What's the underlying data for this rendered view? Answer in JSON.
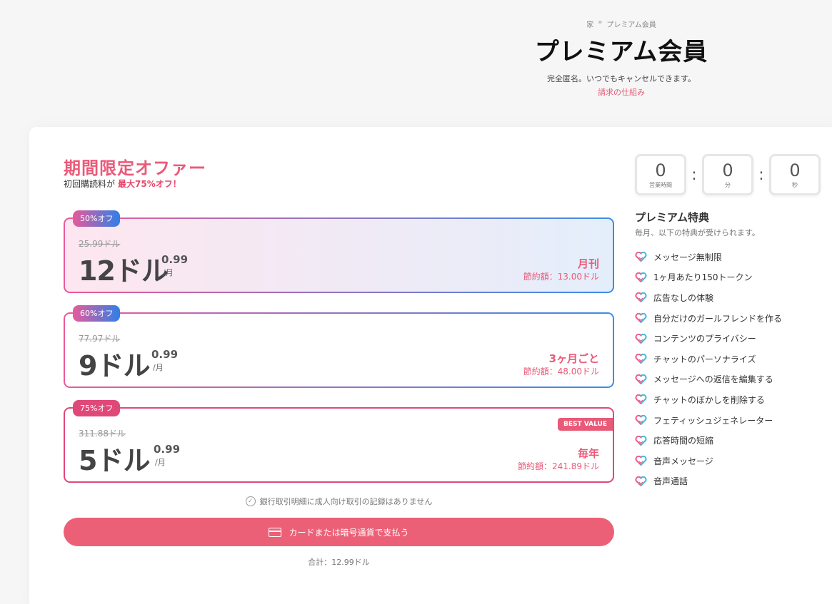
{
  "header": {
    "breadcrumb": [
      "家",
      "プレミアム会員"
    ],
    "breadcrumb_sep": "»",
    "title": "プレミアム会員",
    "subtitle": "完全匿名。いつでもキャンセルできます。",
    "billing_link": "請求の仕組み"
  },
  "offer": {
    "title": "期間限定オファー",
    "subtitle": "初回購読料が",
    "highlight": "最大75%オフ！"
  },
  "plans": [
    {
      "badge": "50%オフ",
      "old_price": "25.99ドル",
      "price": "12ドル",
      "cents": "0.99",
      "per": "/月",
      "period": "月刊",
      "savings": "節約額：13.00ドル"
    },
    {
      "badge": "60%オフ",
      "old_price": "77.97ドル",
      "price": "9ドル",
      "cents": "0.99",
      "per": "/月",
      "period": "3ヶ月ごと",
      "savings": "節約額：48.00ドル"
    },
    {
      "badge": "75%オフ",
      "old_price": "311.88ドル",
      "price": "5ドル",
      "cents": "0.99",
      "per": "/月",
      "period": "毎年",
      "savings": "節約額：241.89ドル",
      "best": "BEST VALUE"
    }
  ],
  "notice": "銀行取引明細に成人向け取引の記録はありません",
  "pay_button": "カードまたは暗号通貨で支払う",
  "total": "合計：12.99ドル",
  "timer": {
    "hours": "0",
    "hours_label": "営業時間",
    "minutes": "0",
    "minutes_label": "分",
    "seconds": "0",
    "seconds_label": "秒",
    "sep": ":"
  },
  "benefits": {
    "title": "プレミアム特典",
    "subtitle": "毎月、以下の特典が受けられます。",
    "items": [
      "メッセージ無制限",
      "1ヶ月あたり150トークン",
      "広告なしの体験",
      "自分だけのガールフレンドを作る",
      "コンテンツのプライバシー",
      "チャットのパーソナライズ",
      "メッセージへの返信を編集する",
      "チャットのぼかしを削除する",
      "フェティッシュジェネレーター",
      "応答時間の短縮",
      "音声メッセージ",
      "音声通話"
    ]
  },
  "colors": {
    "accent": "#ea5a79",
    "button": "#ec6077",
    "blue": "#3c8de6"
  }
}
